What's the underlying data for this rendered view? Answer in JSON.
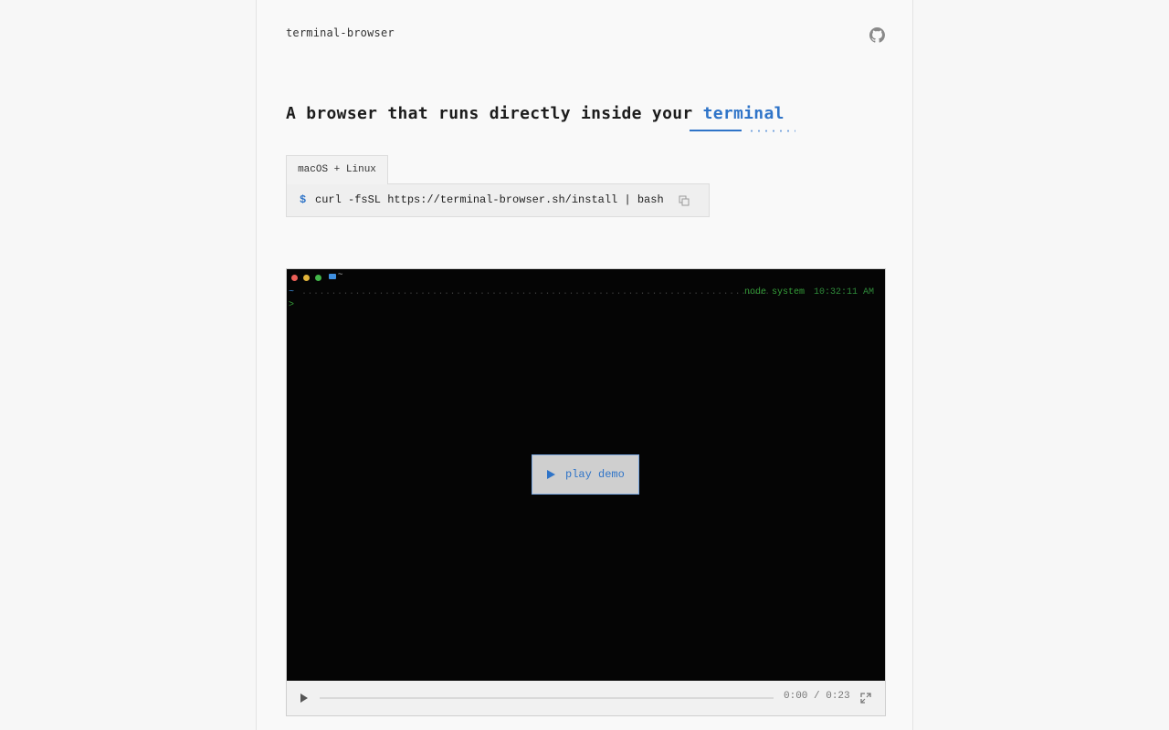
{
  "header": {
    "brand": "terminal-browser",
    "github_icon": "github-icon"
  },
  "hero": {
    "headline_prefix": "A browser that runs directly inside your",
    "headline_word": "terminal"
  },
  "install": {
    "tab_label": "macOS + Linux",
    "prompt": "$",
    "command": "curl -fsSL https://terminal-browser.sh/install | bash",
    "copy_icon": "copy-icon"
  },
  "player": {
    "terminal": {
      "top_tilde": "~",
      "prompt_tilde": "~",
      "dots": "...............................................................................",
      "node_label": "node system",
      "time": "10:32:11 AM",
      "caret": ">",
      "window_dot_colors": [
        "#ec5f57",
        "#e2b43a",
        "#42b649"
      ]
    },
    "play_demo_label": "play demo",
    "controls": {
      "current": "0:00",
      "separator": "/",
      "duration": "0:23",
      "progress": 0
    }
  },
  "colors": {
    "accent": "#2f74c8",
    "terminal_bg": "#050505",
    "prompt_green": "#36a03a"
  }
}
